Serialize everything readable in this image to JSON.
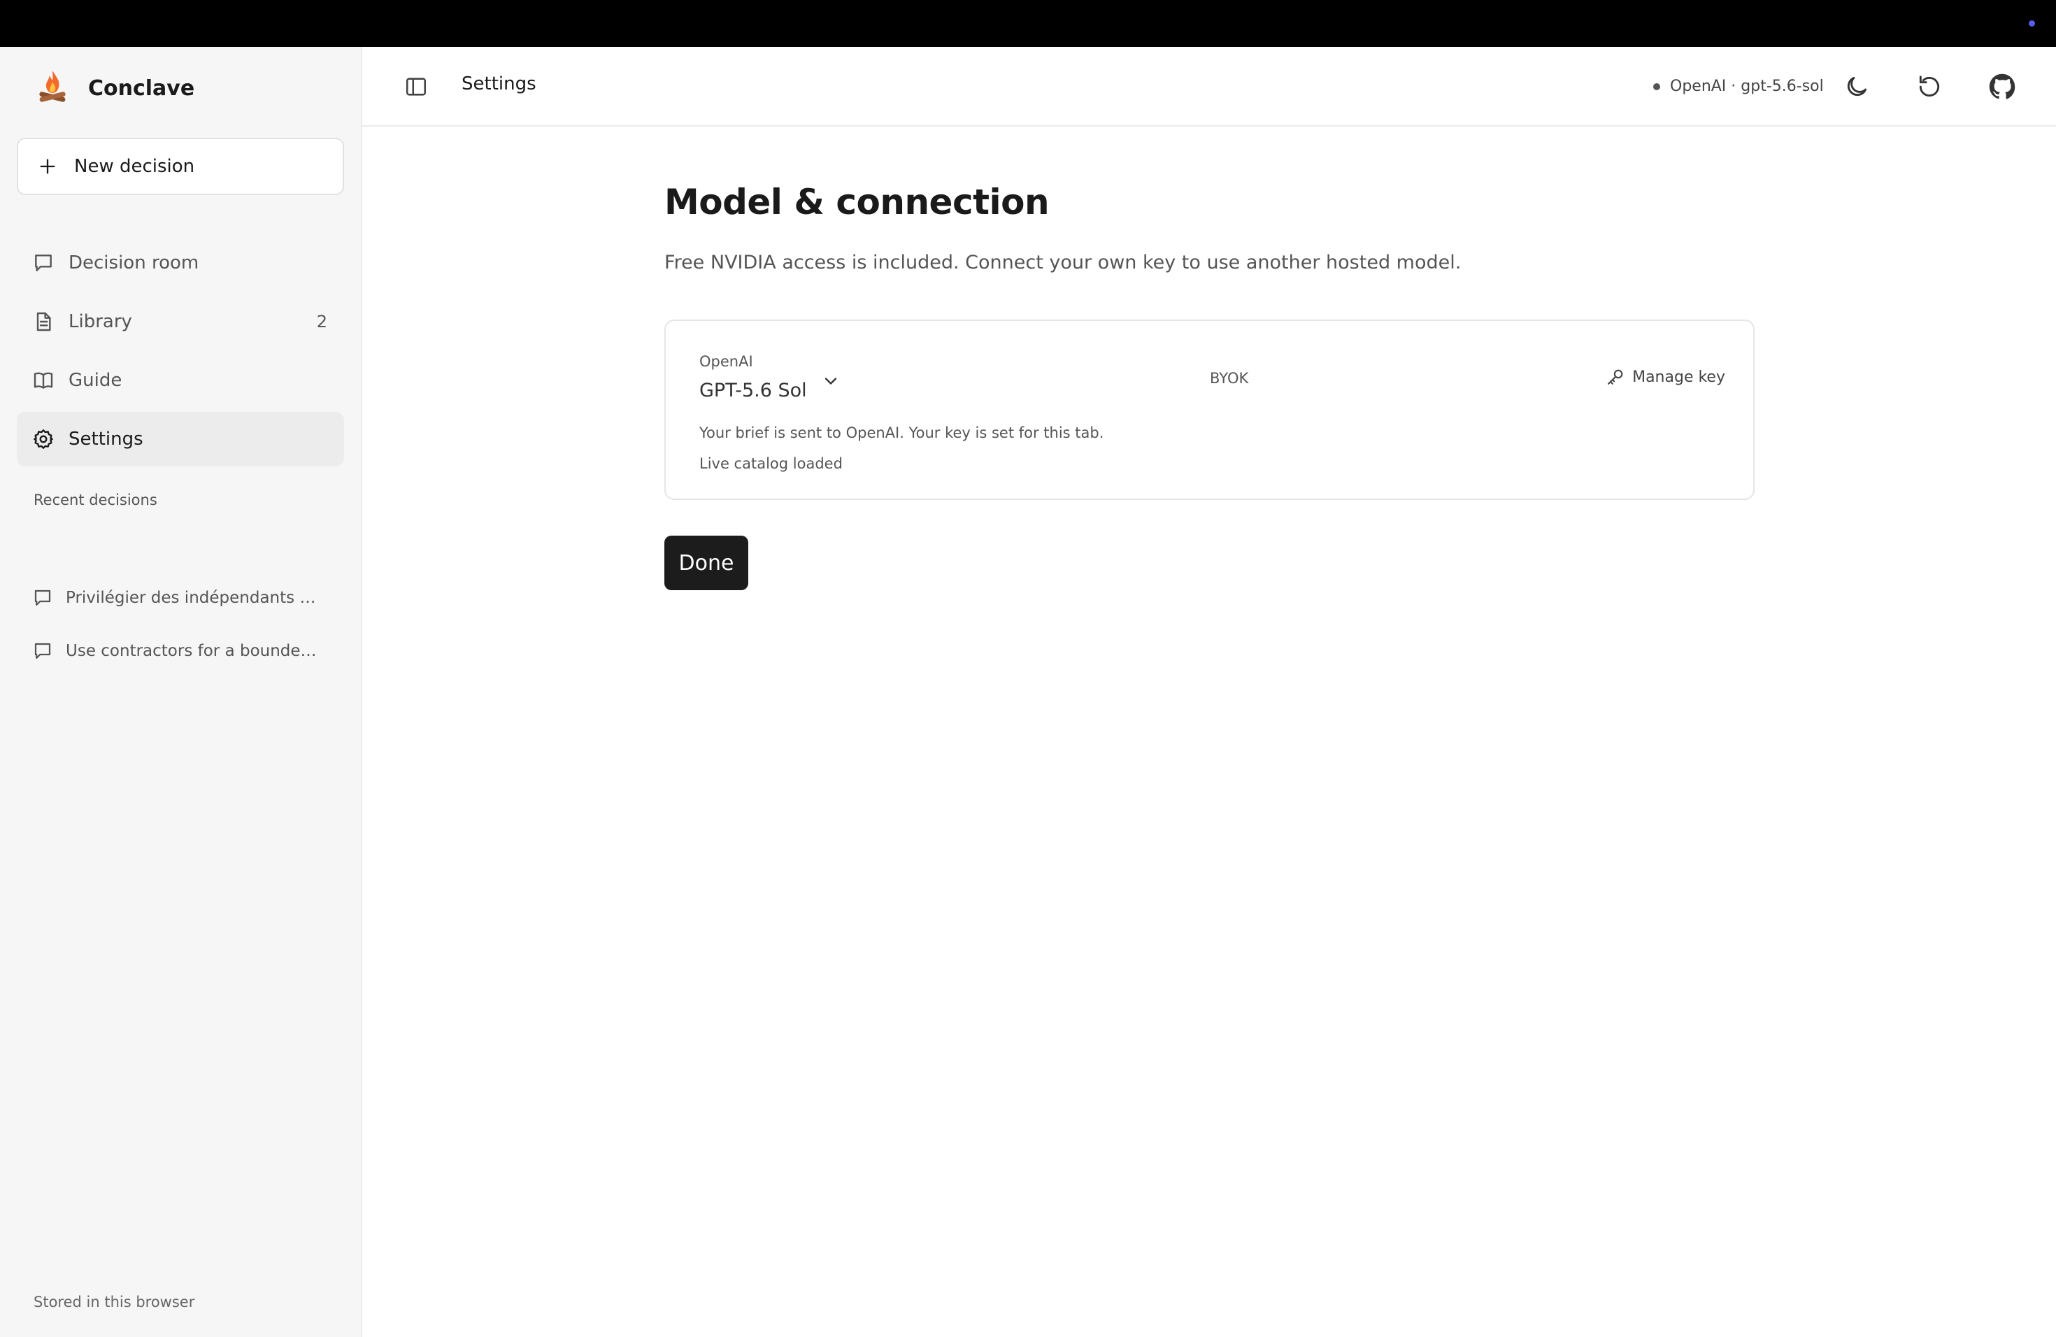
{
  "app": {
    "name": "Conclave"
  },
  "sidebar": {
    "new_decision_label": "New decision",
    "items": [
      {
        "label": "Decision room",
        "icon": "chat-bubble-icon"
      },
      {
        "label": "Library",
        "icon": "document-icon",
        "count": "2"
      },
      {
        "label": "Guide",
        "icon": "book-icon"
      },
      {
        "label": "Settings",
        "icon": "gear-icon",
        "active": true
      }
    ],
    "recent_title": "Recent decisions",
    "recent": [
      {
        "label": "Privilégier des indépendants pen..."
      },
      {
        "label": "Use contractors for a bounded si..."
      }
    ],
    "storage_note": "Stored in this browser"
  },
  "header": {
    "title": "Settings",
    "model_status": "OpenAI · gpt-5.6-sol"
  },
  "main": {
    "title": "Model & connection",
    "subtitle": "Free NVIDIA access is included. Connect your own key to use another hosted model.",
    "card": {
      "provider": "OpenAI",
      "model": "GPT-5.6 Sol",
      "mode": "BYOK",
      "manage_key_label": "Manage key",
      "note": "Your brief is sent to OpenAI. Your key is set for this tab.",
      "catalog_status": "Live catalog loaded"
    },
    "done_label": "Done"
  },
  "colors": {
    "accent_dot": "#5b5bf0",
    "done_button": "#1c1c1c"
  }
}
